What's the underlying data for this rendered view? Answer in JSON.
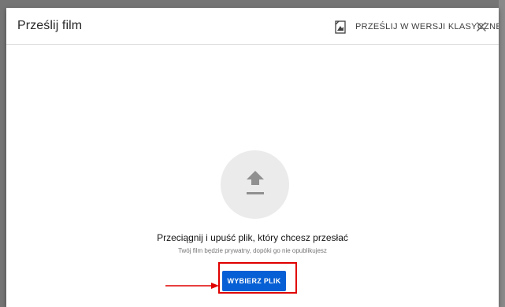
{
  "dialog": {
    "title": "Prześlij film",
    "classic_upload_label": "PRZEŚLIJ W WERSJI KLASYCZNEJ",
    "close_icon": "close-icon",
    "classic_icon": "classic-upload-icon"
  },
  "upload": {
    "icon": "upload-arrow-icon",
    "main_text": "Przeciągnij i upuść plik, który chcesz przesłać",
    "sub_text": "Twój film będzie prywatny, dopóki go nie opublikujesz",
    "select_button_label": "WYBIERZ PLIK"
  },
  "annotation": {
    "highlight_color": "#e00000"
  },
  "colors": {
    "primary_button": "#065fd4",
    "backdrop": "#757575",
    "upload_circle": "#ebebeb"
  }
}
